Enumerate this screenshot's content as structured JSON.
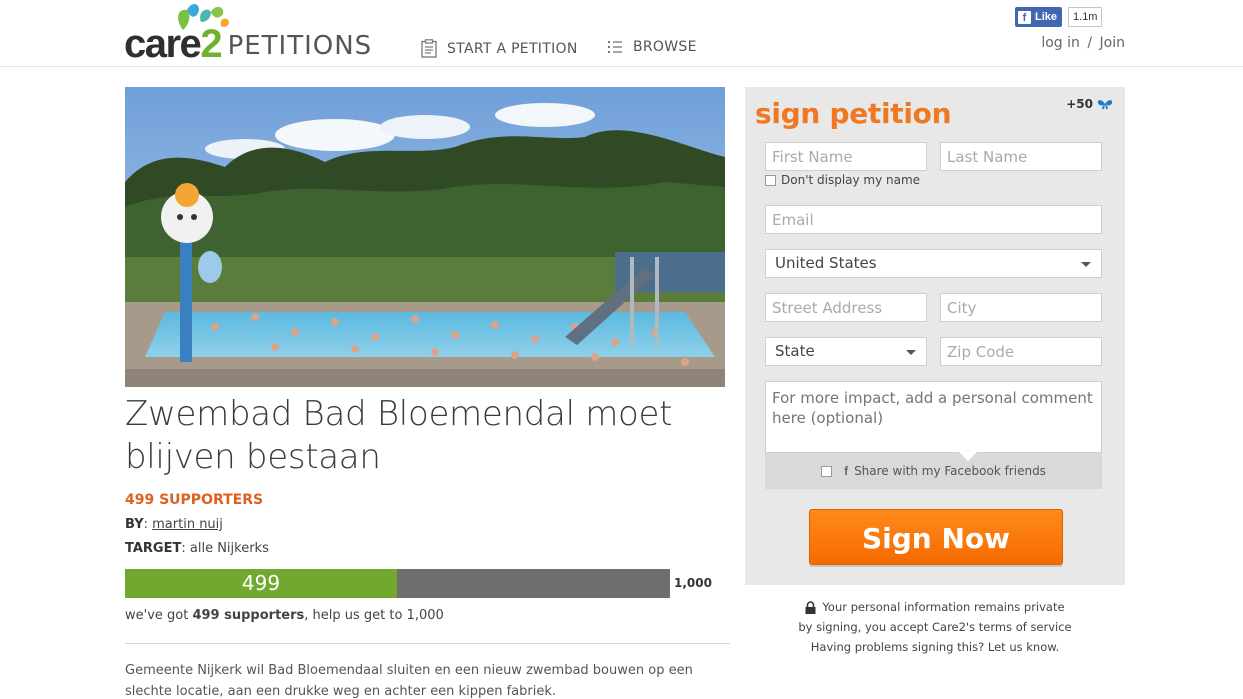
{
  "header": {
    "logo_care": "care",
    "logo_two": "2",
    "logo_petitions": "PETITIONS",
    "nav_start": "START A PETITION",
    "nav_browse": "BROWSE",
    "fb_like_label": "Like",
    "fb_like_count": "1.1m",
    "login_label": "log in",
    "separator": "/",
    "join_label": "Join"
  },
  "petition": {
    "title": "Zwembad Bad Bloemendal moet blijven bestaan",
    "supporters_label": "499 SUPPORTERS",
    "by_label": "BY",
    "author": "martin nuij",
    "target_label": "TARGET",
    "target": "alle Nijkerks",
    "progress_count": "499",
    "progress_fraction": 0.499,
    "goal": "1,000",
    "got_prefix": "we've got ",
    "got_bold": "499 supporters",
    "got_suffix": ", help us get to 1,000",
    "description": "Gemeente Nijkerk wil Bad Bloemendaal sluiten en een nieuw zwembad bouwen op een slechte locatie, aan een drukke weg en achter een kippen fabriek."
  },
  "form": {
    "title": "sign petition",
    "bonus": "+50",
    "first_name_placeholder": "First Name",
    "last_name_placeholder": "Last Name",
    "hide_name_label": "Don't display my name",
    "email_placeholder": "Email",
    "country_value": "United States",
    "street_placeholder": "Street Address",
    "city_placeholder": "City",
    "state_value": "State",
    "zip_placeholder": "Zip Code",
    "comment_placeholder": "For more impact, add a personal comment here (optional)",
    "fb_share_icon": "f",
    "fb_share_label": "Share with my Facebook friends",
    "sign_button": "Sign Now"
  },
  "privacy": {
    "line1": "Your personal information remains private",
    "line2": "by signing, you accept Care2's terms of service",
    "line3": "Having problems signing this? Let us know."
  },
  "colors": {
    "accent_orange": "#f07820",
    "progress_green": "#72a830",
    "progress_gray": "#6f6f6f",
    "brand_green": "#6fb22f",
    "panel_gray": "#e8e8e8"
  },
  "icons": [
    "butterfly-logo-icon",
    "clipboard-icon",
    "list-icon",
    "facebook-icon",
    "blue-butterfly-icon",
    "chevron-down-icon",
    "lock-icon"
  ]
}
